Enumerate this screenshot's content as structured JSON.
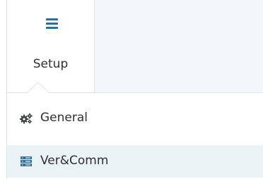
{
  "setup_tab": {
    "label": "Setup",
    "icon": "hamburger-menu-icon"
  },
  "menu": {
    "items": [
      {
        "label": "General",
        "icon": "gears-icon",
        "selected": false
      },
      {
        "label": "Ver&Comm",
        "icon": "server-list-icon",
        "selected": true
      }
    ]
  },
  "colors": {
    "accent": "#2f6f95",
    "selected_row_bg": "#eaf2f6",
    "panel_bg": "#f3f7f9",
    "border": "#dfe3e6",
    "text": "#2c2f33"
  }
}
